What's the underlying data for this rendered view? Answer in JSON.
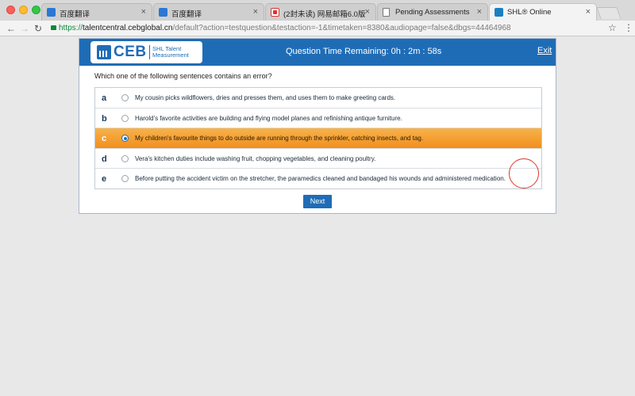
{
  "browser": {
    "tabs": [
      {
        "label": "百度翻译",
        "icon": "baidu-translate-icon"
      },
      {
        "label": "百度翻译",
        "icon": "baidu-translate-icon"
      },
      {
        "label": "(2封未读) 网易邮箱6.0版",
        "icon": "netease-mail-icon"
      },
      {
        "label": "Pending Assessments",
        "icon": "document-icon"
      },
      {
        "label": "SHL® Online",
        "icon": "shl-icon",
        "active": true
      }
    ],
    "url": {
      "scheme": "https://",
      "host": "talentcentral.cebglobal.cn",
      "path": "/default?action=testquestion&testaction=-1&timetaken=8380&audiopage=false&dbgs=44464968"
    }
  },
  "header": {
    "logo_text": "CEB",
    "logo_subtitle": "SHL Talent Measurement",
    "timer": "Question Time Remaining: 0h : 2m : 58s",
    "exit_label": "Exit"
  },
  "question": {
    "prompt": "Which one of the following sentences contains an error?",
    "options": [
      {
        "letter": "a",
        "text": "My cousin picks wildflowers, dries and presses them, and uses them to make greeting cards."
      },
      {
        "letter": "b",
        "text": "Harold's favorite activities are building and flying model planes and refinishing antique furniture."
      },
      {
        "letter": "c",
        "text": "My children's favourite things to do outside are running through the sprinkler, catching insects, and tag."
      },
      {
        "letter": "d",
        "text": "Vera's kitchen duties include washing fruit, chopping vegetables, and cleaning poultry."
      },
      {
        "letter": "e",
        "text": "Before putting the accident victim on the stretcher, the paramedics cleaned and bandaged his wounds and administered medication."
      }
    ],
    "selected": "c"
  },
  "next_label": "Next",
  "colors": {
    "brand_blue": "#1f6cb6",
    "selected_orange": "#f18e1e"
  }
}
